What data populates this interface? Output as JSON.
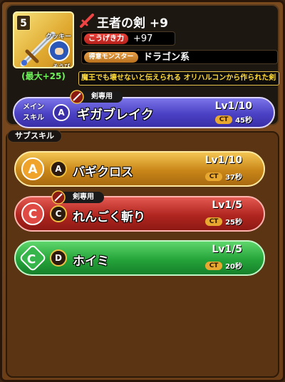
{
  "weapon": {
    "rarity": "5",
    "title": "王者の剣 +9",
    "monster_name": "クッキー",
    "monster_sub": "そうび",
    "max_bonus": "(最大+25)",
    "stat_label": "こうげき力",
    "stat_value": "+97",
    "strong_label": "得意モンスター",
    "strong_value": "ドラゴン系",
    "description": "魔王でも壊せないと伝えられる オリハルコンから作られた剣"
  },
  "main_skill": {
    "label": "メイン スキル",
    "exclusive": "剣専用",
    "grade": "A",
    "name": "ギガブレイク",
    "level": "Lv1/10",
    "ct_label": "CT",
    "ct_value": "45秒"
  },
  "sub_skills_title": "サブスキル",
  "sub_skills": [
    {
      "rank": "A",
      "grade": "A",
      "name": "バギクロス",
      "level": "Lv1/10",
      "ct_label": "CT",
      "ct_value": "37秒"
    },
    {
      "rank": "C",
      "grade": "C",
      "exclusive": "剣専用",
      "name": "れんごく斬り",
      "level": "Lv1/5",
      "ct_label": "CT",
      "ct_value": "25秒"
    },
    {
      "rank": "C",
      "grade": "D",
      "name": "ホイミ",
      "level": "Lv1/5",
      "ct_label": "CT",
      "ct_value": "20秒"
    }
  ],
  "colors": {
    "gold": "#c98618",
    "red": "#b0251f",
    "green": "#25a43a",
    "main": "#4a41c4",
    "desc_text": "#ffdb38",
    "max_bonus": "#6ef25a"
  }
}
